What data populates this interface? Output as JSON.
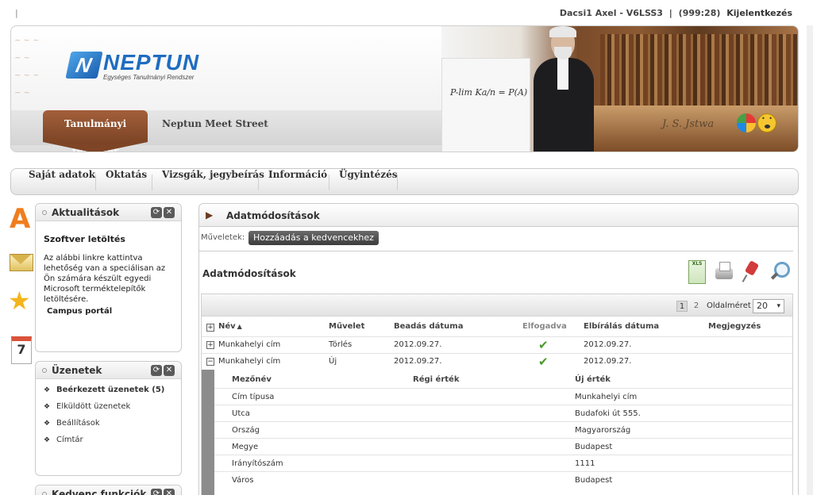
{
  "topbar": {
    "user": "Dacsi1 Axel - V6LSS3",
    "separator": "|",
    "session": "(999:28)",
    "logout": "Kijelentkezés",
    "left_pipe": "|"
  },
  "header": {
    "logo_name": "NEPTUN",
    "logo_tagline": "Egységes Tanulmányi Rendszer",
    "formula": "P-lim Ka/n = P(A)",
    "signature": "J. S. Jstwa",
    "tabs": [
      {
        "label": "Tanulmányi rendszer",
        "active": true
      },
      {
        "label": "Neptun Meet Street",
        "active": false
      }
    ],
    "icons": [
      "color-wheel-icon",
      "smiley-icon"
    ]
  },
  "menu": {
    "items": [
      "Saját adatok",
      "Oktatás",
      "Vizsgák, jegybeírás",
      "Információ",
      "Ügyintézés"
    ]
  },
  "side_icons": [
    "news-a-icon",
    "mail-icon",
    "star-icon",
    "calendar-icon"
  ],
  "news_panel": {
    "title": "Aktualitások",
    "item_title": "Szoftver letöltés",
    "item_text": "Az alábbi linkre kattintva lehetőség van a speciálisan az Ön számára készült egyedi Microsoft terméktelepítők letöltésére.",
    "link": "Campus portál"
  },
  "messages_panel": {
    "title": "Üzenetek",
    "items": [
      {
        "label": "Beérkezett üzenetek (5)",
        "bold": true
      },
      {
        "label": "Elküldött üzenetek",
        "bold": false
      },
      {
        "label": "Beállítások",
        "bold": false
      },
      {
        "label": "Címtár",
        "bold": false
      }
    ]
  },
  "favorites_panel": {
    "title": "Kedvenc funkciók"
  },
  "main": {
    "title": "Adatmódosítások",
    "ops_label": "Műveletek:",
    "fav_button": "Hozzáadás a kedvencekhez",
    "subtitle": "Adatmódosítások",
    "tools": [
      "xls-export-icon",
      "print-icon",
      "pin-icon",
      "search-icon"
    ],
    "pager": {
      "pages": [
        "1",
        "2"
      ],
      "active_page": "1",
      "pagesize_label": "Oldalméret",
      "pagesize": "20"
    },
    "columns": [
      "Név",
      "Művelet",
      "Beadás dátuma",
      "Elfogadva",
      "Elbírálás dátuma",
      "Megjegyzés"
    ],
    "sort_marker": "▲",
    "rows": [
      {
        "expander": "+",
        "name": "Munkahelyi cím",
        "action": "Törlés",
        "submitted": "2012.09.27.",
        "accepted": true,
        "decided": "2012.09.27.",
        "note": ""
      },
      {
        "expander": "−",
        "name": "Munkahelyi cím",
        "action": "Új",
        "submitted": "2012.09.27.",
        "accepted": true,
        "decided": "2012.09.27.",
        "note": ""
      }
    ],
    "detail": {
      "columns": [
        "Mezőnév",
        "Régi érték",
        "Új érték"
      ],
      "rows": [
        {
          "field": "Cím típusa",
          "old": "",
          "new": "Munkahelyi cím"
        },
        {
          "field": "Utca",
          "old": "",
          "new": "Budafoki út 555."
        },
        {
          "field": "Ország",
          "old": "",
          "new": "Magyarország"
        },
        {
          "field": "Megye",
          "old": "",
          "new": "Budapest"
        },
        {
          "field": "Irányítószám",
          "old": "",
          "new": "1111"
        },
        {
          "field": "Város",
          "old": "",
          "new": "Budapest"
        }
      ]
    }
  },
  "colors": {
    "brand_brown": "#7d4526",
    "logo_blue": "#1f6cc0",
    "check_green": "#4a9a2a"
  }
}
